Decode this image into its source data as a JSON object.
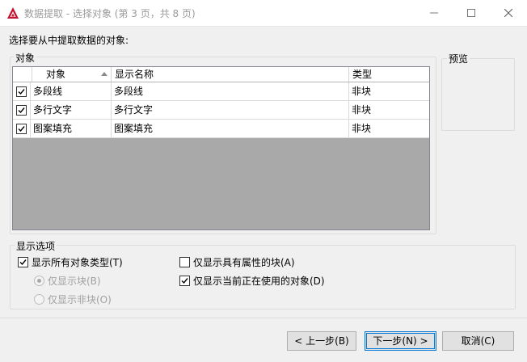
{
  "window": {
    "title": "数据提取 - 选择对象 (第 3 页，共 8 页)"
  },
  "prompt": "选择要从中提取数据的对象:",
  "objects_group": {
    "legend": "对象",
    "columns": {
      "object": "对象",
      "display_name": "显示名称",
      "type": "类型"
    },
    "sort": {
      "column": "object",
      "direction": "ascending"
    },
    "rows": [
      {
        "checked": true,
        "object": "多段线",
        "display_name": "多段线",
        "type": "非块"
      },
      {
        "checked": true,
        "object": "多行文字",
        "display_name": "多行文字",
        "type": "非块"
      },
      {
        "checked": true,
        "object": "图案填充",
        "display_name": "图案填充",
        "type": "非块"
      }
    ]
  },
  "preview": {
    "legend": "预览"
  },
  "display_options": {
    "legend": "显示选项",
    "show_all_types": {
      "label": "显示所有对象类型(T)",
      "checked": true
    },
    "blocks_only": {
      "label": "仅显示块(B)",
      "selected": true,
      "enabled": false
    },
    "non_blocks_only": {
      "label": "仅显示非块(O)",
      "selected": false,
      "enabled": false
    },
    "blocks_with_attributes": {
      "label": "仅显示具有属性的块(A)",
      "checked": false
    },
    "objects_in_use": {
      "label": "仅显示当前正在使用的对象(D)",
      "checked": true
    }
  },
  "buttons": {
    "prev": "< 上一步(B)",
    "next": "下一步(N) >",
    "cancel": "取消(C)"
  },
  "colors": {
    "title_icon": "#c8102e",
    "table_empty_area": "#a9a9a9",
    "default_button_border": "#0078d7"
  }
}
